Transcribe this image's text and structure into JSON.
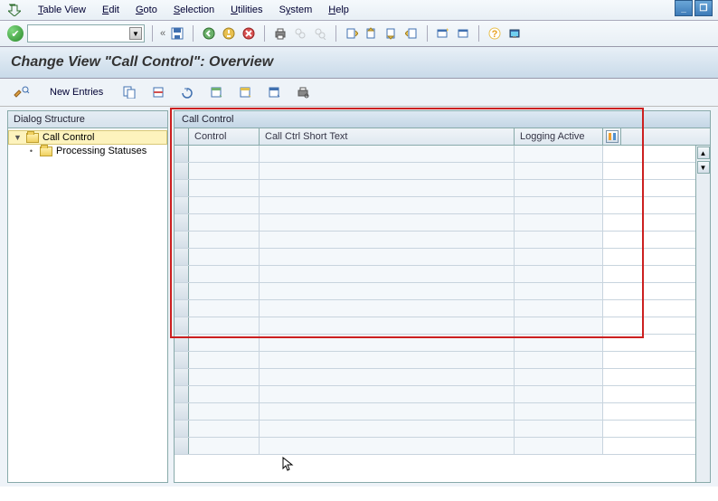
{
  "menu": {
    "items": [
      "Table View",
      "Edit",
      "Goto",
      "Selection",
      "Utilities",
      "System",
      "Help"
    ],
    "underlines": [
      "T",
      "E",
      "G",
      "S",
      "U",
      "y",
      "H"
    ]
  },
  "title": "Change View \"Call Control\": Overview",
  "actionbar": {
    "new_entries": "New Entries"
  },
  "dialog_structure": {
    "header": "Dialog Structure",
    "root": "Call Control",
    "child": "Processing Statuses"
  },
  "table": {
    "title": "Call Control",
    "columns": {
      "control": "Control",
      "short_text": "Call Ctrl Short Text",
      "logging": "Logging Active"
    },
    "row_count": 18
  }
}
